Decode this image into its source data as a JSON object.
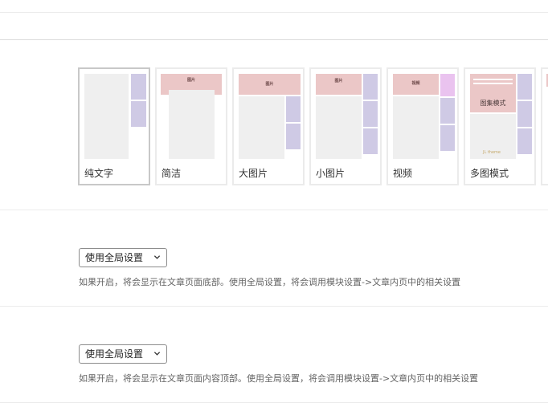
{
  "layout_options": [
    {
      "key": "text",
      "label": "纯文字",
      "selected": true
    },
    {
      "key": "simple",
      "label": "简洁",
      "tag": "图片"
    },
    {
      "key": "large-image",
      "label": "大图片",
      "tag": "图片"
    },
    {
      "key": "small-image",
      "label": "小图片",
      "tag": "图片"
    },
    {
      "key": "video",
      "label": "视频",
      "tag": "视频"
    },
    {
      "key": "multi-image",
      "label": "多图模式",
      "tag": "图集模式",
      "watermark": "JL theme"
    }
  ],
  "settings": [
    {
      "select_value": "使用全局设置",
      "description": "如果开启，将会显示在文章页面底部。使用全局设置，将会调用模块设置->文章内页中的相关设置"
    },
    {
      "select_value": "使用全局设置",
      "description": "如果开启，将会显示在文章页面内容顶部。使用全局设置，将会调用模块设置->文章内页中的相关设置"
    }
  ],
  "colors": {
    "placeholder_gray": "#efefef",
    "sidebar_purple": "#cfcae5",
    "image_pink": "#ebc7c7",
    "video_magenta": "#eac3ef"
  }
}
